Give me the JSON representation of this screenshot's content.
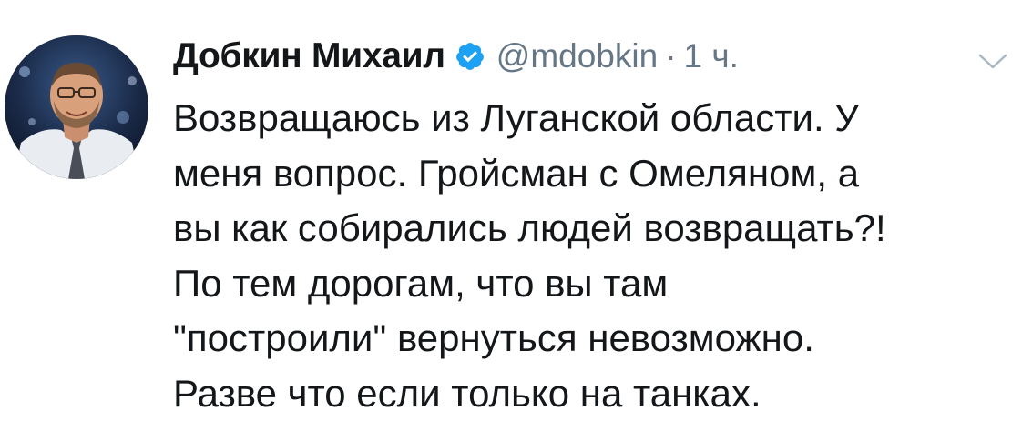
{
  "tweet": {
    "author": {
      "name": "Добкин Михаил",
      "handle": "@mdobkin",
      "verified": true
    },
    "separator": "·",
    "time": "1 ч.",
    "text_lines": [
      "Возвращаюсь из Луганской области. У",
      "меня вопрос. Гройсман с Омеляном, а",
      "вы как собирались людей возвращать?!",
      "По тем дорогам, что вы там",
      "\"построили\" вернуться невозможно.",
      "Разве что если только на танках."
    ]
  },
  "icons": {
    "verified": "verified-badge-icon",
    "more": "chevron-down-icon"
  },
  "colors": {
    "verified_blue": "#1da1f2",
    "secondary_text": "#657786",
    "primary_text": "#14171a"
  }
}
